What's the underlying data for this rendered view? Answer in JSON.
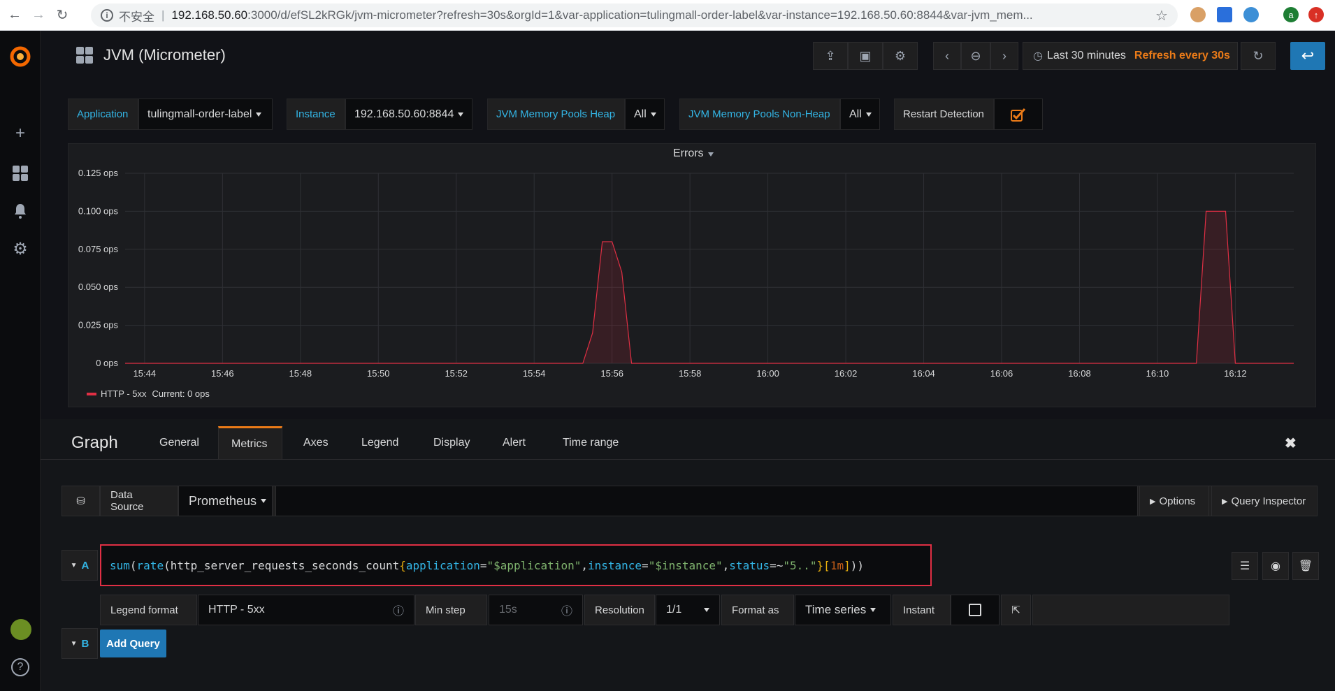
{
  "browser": {
    "insecure_label": "不安全",
    "host": "192.168.50.60",
    "url_rest": ":3000/d/efSL2kRGk/jvm-micrometer?refresh=30s&orgId=1&var-application=tulingmall-order-label&var-instance=192.168.50.60:8844&var-jvm_mem...",
    "profile_initial": "a"
  },
  "topbar": {
    "title": "JVM (Micrometer)",
    "time_range": "Last 30 minutes",
    "refresh": "Refresh every 30s"
  },
  "variables": [
    {
      "label": "Application",
      "value": "tulingmall-order-label"
    },
    {
      "label": "Instance",
      "value": "192.168.50.60:8844"
    },
    {
      "label": "JVM Memory Pools Heap",
      "value": "All"
    },
    {
      "label": "JVM Memory Pools Non-Heap",
      "value": "All"
    },
    {
      "label": "Restart Detection",
      "checked": true
    }
  ],
  "panel": {
    "title": "Errors",
    "legend": "HTTP - 5xx",
    "legend_current": "Current: 0 ops"
  },
  "chart_data": {
    "type": "line",
    "title": "Errors",
    "x": [
      "15:44",
      "15:46",
      "15:48",
      "15:50",
      "15:52",
      "15:54",
      "15:56",
      "15:58",
      "16:00",
      "16:02",
      "16:04",
      "16:06",
      "16:08",
      "16:10",
      "16:12"
    ],
    "y_ticks": [
      "0 ops",
      "0.025 ops",
      "0.050 ops",
      "0.075 ops",
      "0.100 ops",
      "0.125 ops"
    ],
    "ylim": [
      0,
      0.125
    ],
    "series": [
      {
        "name": "HTTP - 5xx",
        "color": "#e02f44",
        "points": [
          [
            "15:43.5",
            0
          ],
          [
            "15:55.25",
            0
          ],
          [
            "15:55.5",
            0.02
          ],
          [
            "15:55.75",
            0.08
          ],
          [
            "15:56",
            0.08
          ],
          [
            "15:56.25",
            0.06
          ],
          [
            "15:56.5",
            0
          ],
          [
            "16:11.0",
            0
          ],
          [
            "16:11.25",
            0.1
          ],
          [
            "16:11.5",
            0.1
          ],
          [
            "16:11.75",
            0.1
          ],
          [
            "16:12.0",
            0
          ],
          [
            "16:13.5",
            0
          ]
        ]
      }
    ],
    "grid": true,
    "legend": "bottom-left"
  },
  "editor": {
    "title": "Graph",
    "tabs": [
      "General",
      "Metrics",
      "Axes",
      "Legend",
      "Display",
      "Alert",
      "Time range"
    ],
    "active_tab": "Metrics",
    "data_source_label": "Data Source",
    "data_source": "Prometheus",
    "options_label": "Options",
    "query_inspector_label": "Query Inspector",
    "query_a_letter": "A",
    "query_b_letter": "B",
    "query_a_tokens": [
      {
        "t": "sum",
        "c": "tok-fn"
      },
      {
        "t": "(",
        "c": "tok-op"
      },
      {
        "t": "rate",
        "c": "tok-fn"
      },
      {
        "t": "(",
        "c": "tok-op"
      },
      {
        "t": "http_server_requests_seconds_count",
        "c": "tok-name"
      },
      {
        "t": "{",
        "c": "tok-br"
      },
      {
        "t": "application",
        "c": "tok-label"
      },
      {
        "t": "=",
        "c": "tok-op"
      },
      {
        "t": "\"$application\"",
        "c": "tok-str"
      },
      {
        "t": ", ",
        "c": "tok-op"
      },
      {
        "t": "instance",
        "c": "tok-label"
      },
      {
        "t": "=",
        "c": "tok-op"
      },
      {
        "t": "\"$instance\"",
        "c": "tok-str"
      },
      {
        "t": ", ",
        "c": "tok-op"
      },
      {
        "t": "status",
        "c": "tok-label"
      },
      {
        "t": "=~",
        "c": "tok-op"
      },
      {
        "t": "\"5..\"",
        "c": "tok-str"
      },
      {
        "t": "}",
        "c": "tok-br"
      },
      {
        "t": "[",
        "c": "tok-br"
      },
      {
        "t": "1m",
        "c": "tok-num"
      },
      {
        "t": "]",
        "c": "tok-br"
      },
      {
        "t": "))",
        "c": "tok-op"
      }
    ],
    "legend_format_label": "Legend format",
    "legend_format_value": "HTTP - 5xx",
    "min_step_label": "Min step",
    "min_step_placeholder": "15s",
    "resolution_label": "Resolution",
    "resolution_value": "1/1",
    "format_as_label": "Format as",
    "format_as_value": "Time series",
    "instant_label": "Instant",
    "add_query_label": "Add Query"
  }
}
